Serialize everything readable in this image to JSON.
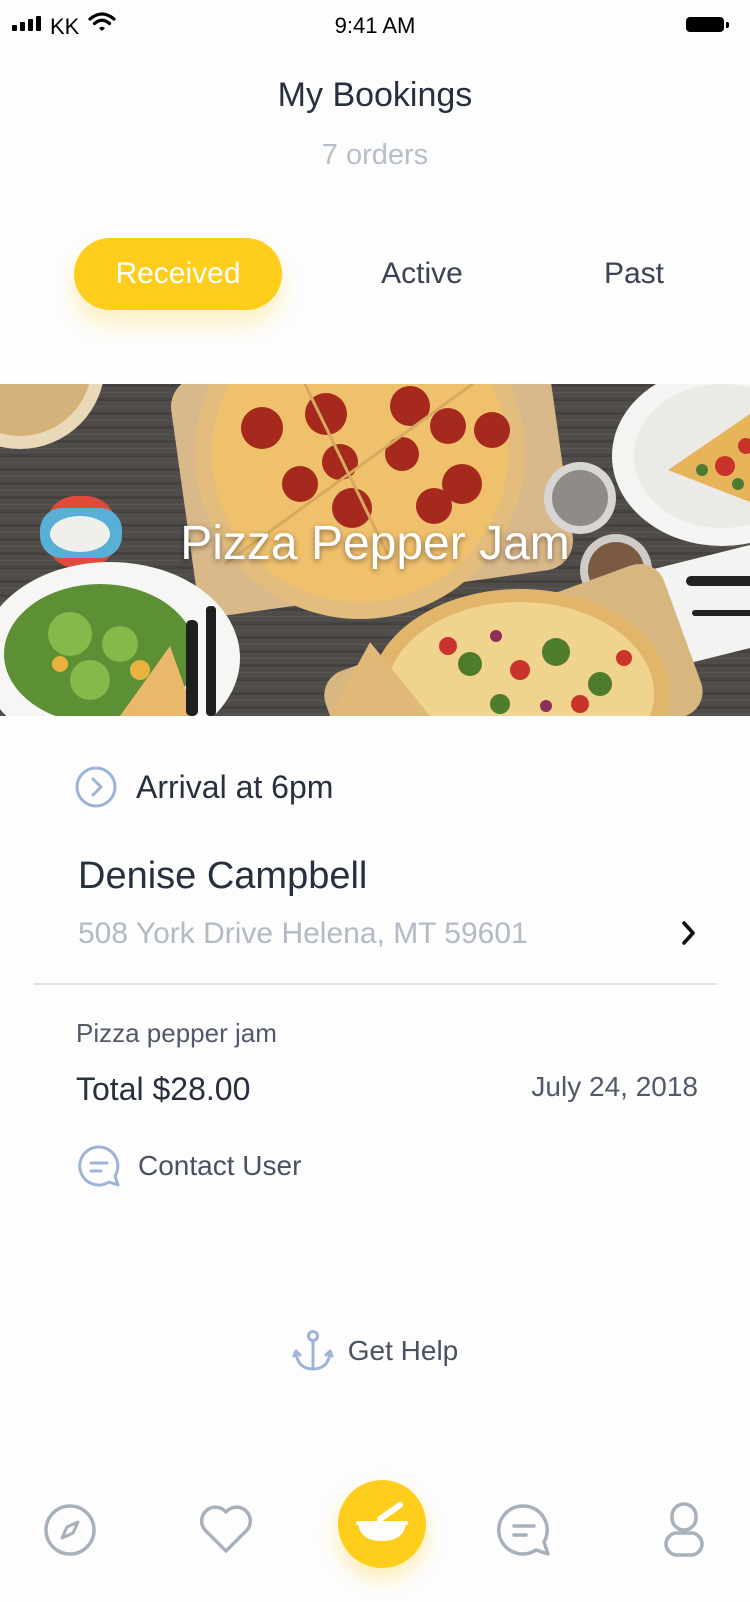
{
  "status_bar": {
    "carrier": "KK",
    "time": "9:41 AM"
  },
  "header": {
    "title": "My Bookings",
    "subtitle": "7 orders"
  },
  "tabs": [
    {
      "label": "Received",
      "active": true
    },
    {
      "label": "Active",
      "active": false
    },
    {
      "label": "Past",
      "active": false
    }
  ],
  "booking": {
    "hero_title": "Pizza Pepper Jam",
    "arrival": "Arrival at 6pm",
    "customer_name": "Denise Campbell",
    "address": "508 York Drive Helena, MT 59601",
    "item": "Pizza pepper jam",
    "total": "Total $28.00",
    "date": "July 24, 2018",
    "contact_label": "Contact User"
  },
  "help": {
    "label": "Get Help"
  },
  "bottom_nav": [
    {
      "icon": "compass-icon"
    },
    {
      "icon": "heart-icon"
    },
    {
      "icon": "bowl-icon",
      "active": true
    },
    {
      "icon": "chat-icon"
    },
    {
      "icon": "user-icon"
    }
  ],
  "colors": {
    "accent": "#ffcd1c",
    "icon_blue": "#9db4d8",
    "icon_gray": "#a8b0bb",
    "text_dark": "#28303f",
    "text_muted": "#b3bac4"
  }
}
